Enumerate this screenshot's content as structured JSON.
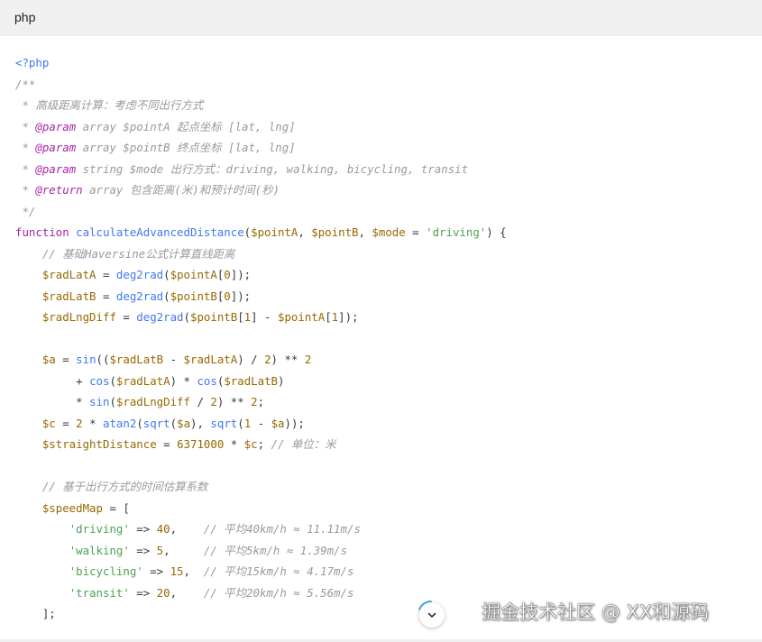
{
  "header": {
    "language": "php"
  },
  "code": {
    "open_tag": "<?php",
    "doc_open": "/**",
    "doc_desc": " * 高级距离计算：考虑不同出行方式",
    "param_tag": "@param",
    "return_tag": "@return",
    "doc_param_a": " array $pointA 起点坐标 [lat, lng]",
    "doc_param_b": " array $pointB 终点坐标 [lat, lng]",
    "doc_param_mode": " string $mode 出行方式：driving, walking, bicycling, transit",
    "doc_return": " array 包含距离(米)和预计时间(秒)",
    "doc_close": " */",
    "kw_function": "function",
    "fn_name": "calculateAdvancedDistance",
    "var_pointA": "$pointA",
    "var_pointB": "$pointB",
    "var_mode": "$mode",
    "str_driving": "'driving'",
    "comment_haversine": "// 基础Haversine公式计算直线距离",
    "var_radLatA": "$radLatA",
    "var_radLatB": "$radLatB",
    "var_radLngDiff": "$radLngDiff",
    "fn_deg2rad": "deg2rad",
    "fn_sin": "sin",
    "fn_cos": "cos",
    "fn_atan2": "atan2",
    "fn_sqrt": "sqrt",
    "var_a": "$a",
    "var_c": "$c",
    "var_straight": "$straightDistance",
    "num_6371000": "6371000",
    "comment_unit": "// 单位：米",
    "comment_speed": "// 基于出行方式的时间估算系数",
    "var_speedMap": "$speedMap",
    "str_walking": "'walking'",
    "str_bicycling": "'bicycling'",
    "str_transit": "'transit'",
    "num_40": "40",
    "num_5": "5",
    "num_15": "15",
    "num_20": "20",
    "comment_40": "// 平均40km/h ≈ 11.11m/s",
    "comment_5": "// 平均5km/h ≈ 1.39m/s",
    "comment_15": "// 平均15km/h ≈ 4.17m/s",
    "comment_20": "// 平均20km/h ≈ 5.56m/s",
    "close_array": "];"
  },
  "scroll_button": {
    "icon": "chevron-down-icon"
  },
  "watermark": {
    "text": "掘金技术社区 @ XX和源码"
  }
}
